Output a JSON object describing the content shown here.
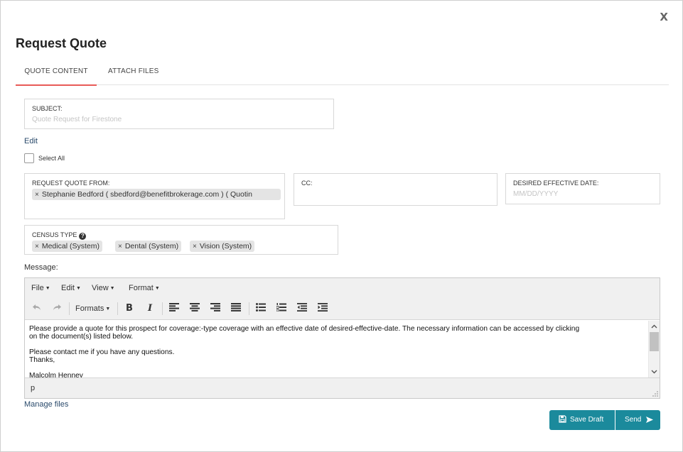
{
  "modal": {
    "title": "Request Quote",
    "close_label": "X"
  },
  "tabs": [
    {
      "label": "QUOTE CONTENT",
      "active": true
    },
    {
      "label": "ATTACH FILES",
      "active": false
    }
  ],
  "subject": {
    "label": "SUBJECT:",
    "placeholder": "Quote Request for Firestone"
  },
  "edit_link": "Edit",
  "select_all": {
    "label": "Select All",
    "checked": false
  },
  "request_from": {
    "label": "REQUEST QUOTE FROM:",
    "chips": [
      "Stephanie Bedford ( sbedford@benefitbrokerage.com ) ( Quotin"
    ]
  },
  "cc": {
    "label": "CC:"
  },
  "effective_date": {
    "label": "DESIRED EFFECTIVE DATE:",
    "placeholder": "MM/DD/YYYY"
  },
  "census_type": {
    "label": "CENSUS TYPE",
    "help_icon": "?",
    "chips": [
      "Medical (System)",
      "Dental (System)",
      "Vision (System)"
    ]
  },
  "message_label": "Message:",
  "editor": {
    "menus": [
      "File",
      "Edit",
      "View",
      "Format"
    ],
    "formats_label": "Formats",
    "icons": [
      "undo-icon",
      "redo-icon",
      "bold-icon",
      "italic-icon",
      "align-left-icon",
      "align-center-icon",
      "align-right-icon",
      "align-justify-icon",
      "bullet-list-icon",
      "numbered-list-icon",
      "outdent-icon",
      "indent-icon"
    ],
    "content": {
      "line1": "Please provide a quote for this prospect for coverage:-type coverage with an effective date of desired-effective-date. The necessary information can be accessed by clicking",
      "line2": "on the document(s) listed below.",
      "line3": "Please contact me if you have any questions.",
      "line4": "Thanks,",
      "line5": "Malcolm Henney"
    },
    "status_path": "p"
  },
  "manage_files_link": "Manage files",
  "buttons": {
    "save_draft": "Save Draft",
    "send": "Send"
  },
  "colors": {
    "accent_tab": "#e85b57",
    "button": "#1b8a9c",
    "link": "#2a4a6b"
  }
}
